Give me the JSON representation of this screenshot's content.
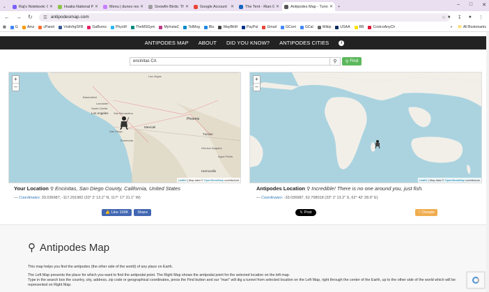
{
  "browser": {
    "tabs": [
      {
        "title": "Raj's Notebook: Open Ch",
        "color": "#7b61ff"
      },
      {
        "title": "Hualia National Park - G",
        "color": "#8bc34a"
      },
      {
        "title": "Menu | dunes restaurant",
        "color": "#c77dff"
      },
      {
        "title": "Snowfin Birds: The Day w",
        "color": "#9e9e9e"
      },
      {
        "title": "Google Account",
        "color": "#ea4335"
      },
      {
        "title": "The Tent - Rian Growff",
        "color": "#1565c0"
      },
      {
        "title": "Antipodes Map - Tunnel",
        "color": "#555555",
        "active": true
      }
    ],
    "url": "antipodesmap.com",
    "bookmarks": [
      "G",
      "Amz",
      "cPanel",
      "VndnfrgSFB",
      "GaBurns",
      "PhysM",
      "TheMSGym",
      "MyInstaC",
      "TelMsg",
      "Blu",
      "WayBkM",
      "PayPal",
      "Gmail",
      "GCont",
      "GCal",
      "Wikip",
      "USAA",
      "BB",
      "CostcoAnyCh"
    ],
    "bookmark_colors": [
      "#4285f4",
      "#ff9900",
      "#ff6c2c",
      "#3b5998",
      "#e91e63",
      "#29b6f6",
      "#00897b",
      "#c13584",
      "#0088cc",
      "#1e88e5",
      "#444444",
      "#003087",
      "#ea4335",
      "#4285f4",
      "#4285f4",
      "#666666",
      "#002a5c",
      "#ffe000",
      "#e31837"
    ],
    "all_bookmarks": "All Bookmarks"
  },
  "nav": {
    "items": [
      "ANTIPODES MAP",
      "ABOUT",
      "DID YOU KNOW?",
      "ANTIPODES CITIES"
    ],
    "info_icon": "info-icon"
  },
  "search": {
    "value": "encinitas CA",
    "find_label": "Find"
  },
  "left_map": {
    "attribution_leaflet": "Leaflet",
    "attribution_text": " | Map data © ",
    "attribution_osm": "OpenStreetMap",
    "attribution_contrib": " contributors",
    "places": [
      "Las Vegas",
      "Bakersfield",
      "Lancaster",
      "Santa Clarita",
      "Los Angeles",
      "San Bernardino",
      "Phoenix",
      "Mexicali",
      "San Diego",
      "Tucson",
      "Ensenada",
      "Hermosillo",
      "Heroica Nogales",
      "Agua Prieta"
    ]
  },
  "right_map": {
    "attribution_leaflet": "Leaflet",
    "attribution_text": " | Map data © ",
    "attribution_osm": "OpenStreetMap",
    "attribution_contrib": " contributors"
  },
  "your_location": {
    "label": "Your Location",
    "value": "Encinitas, San Diego County, California, United States",
    "coord_label": "Coordinates:",
    "coord_value": "33.036987, -117.291982 (33° 2' 13.2\" N, 117° 17' 31.1\" W)"
  },
  "antipodes_location": {
    "label": "Antipodes Location",
    "value": "Incredible! There is no one around you, just fish.",
    "coord_label": "Coordinates:",
    "coord_value": "-33.036987, 62.708018 (33° 2' 13.2\" S, 62° 42' 28.9\" E)"
  },
  "social": {
    "like": "Like 109K",
    "share": "Share",
    "post": "Post",
    "donate": "Donate"
  },
  "content": {
    "heading": "Antipodes Map",
    "p1": "This map helps you find the antipodes (the other side of the world) of any place on Earth.",
    "p2": "The Left Map presents the place for which you want to find the antipodal point. The Right Map shows the antipodal point for the selected location on the left map.",
    "p3": "Type in the search box the country, city, address, zip code or geographical coordinates, press the Find button and our \"man\" will dig a tunnel from selected location on the Left Map, right through the center of the Earth, up to the other side of the world which will be represented on Right Map."
  }
}
